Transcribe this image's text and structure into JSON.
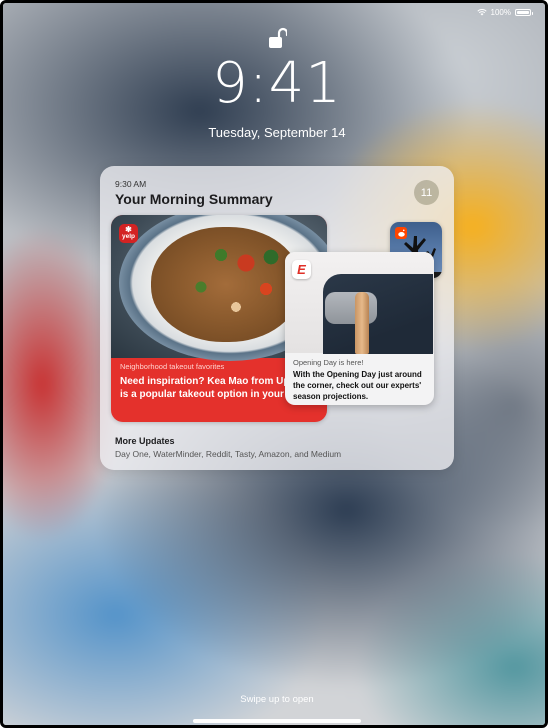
{
  "status_bar": {
    "battery_text": "100%",
    "battery_level": 1.0,
    "icons": [
      "wifi-icon",
      "battery-icon"
    ]
  },
  "lock_screen": {
    "lock_icon": "unlocked-padlock-icon",
    "time": "9:41",
    "date": "Tuesday, September 14"
  },
  "summary": {
    "time": "9:30 AM",
    "title": "Your Morning Summary",
    "count": "11",
    "cards": {
      "yelp": {
        "app_icon": "yelp-app-icon",
        "app_label": "yelp",
        "eyebrow": "Neighborhood takeout favorites",
        "body": "Need inspiration? Kea Mao from Up Thai is a popular takeout option in your area."
      },
      "espn": {
        "app_icon": "espn-app-icon",
        "app_label": "E",
        "eyebrow": "Opening Day is here!",
        "body": "With the Opening Day just around the corner, check out our experts' season projections."
      },
      "reddit": {
        "app_icon": "reddit-app-icon"
      }
    },
    "more_updates": {
      "title": "More Updates",
      "apps": "Day One, WaterMinder, Reddit, Tasty, Amazon, and Medium"
    }
  },
  "footer": {
    "swipe_text": "Swipe up to open"
  },
  "colors": {
    "yelp_red": "#e4312c",
    "espn_red": "#e02f27",
    "reddit_orange": "#ff4500"
  }
}
